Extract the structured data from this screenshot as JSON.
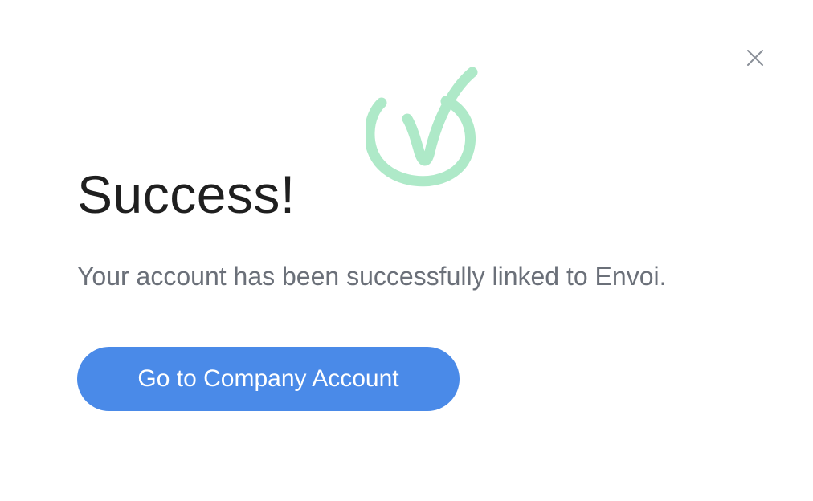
{
  "modal": {
    "close_icon": "close-icon",
    "success_icon": "checkmark-circle-icon",
    "accent_color": "#aee9c8",
    "title": "Success!",
    "message": "Your account has been successfully linked to Envoi.",
    "cta_label": "Go to Company Account",
    "cta_color": "#4a8ae8"
  }
}
